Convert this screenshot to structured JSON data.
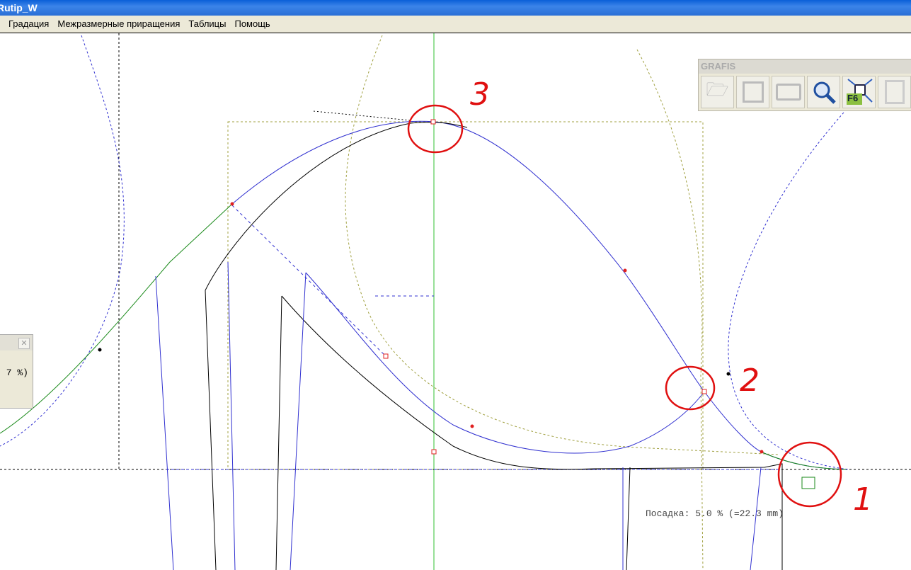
{
  "window": {
    "title": "Rutip_W"
  },
  "menu": [
    "Градация",
    "Межразмерные приращения",
    "Таблицы",
    "Помощь"
  ],
  "toolbar": {
    "title": "GRAFIS",
    "buttons": [
      "open-icon",
      "save-icon",
      "print-icon",
      "zoom-icon",
      "fit-f6-icon",
      "export-icon"
    ],
    "f6_label": "F6"
  },
  "panel": {
    "value": "7 %)"
  },
  "status": {
    "posadka": "Посадка: 5.0 % (=22.3 mm)"
  },
  "annotations": [
    "1",
    "2",
    "3"
  ],
  "colors": {
    "curve_blue": "#3030d0",
    "curve_green": "#1a8a1a",
    "guide_olive": "#a0a040",
    "annotation_red": "#e01010"
  }
}
